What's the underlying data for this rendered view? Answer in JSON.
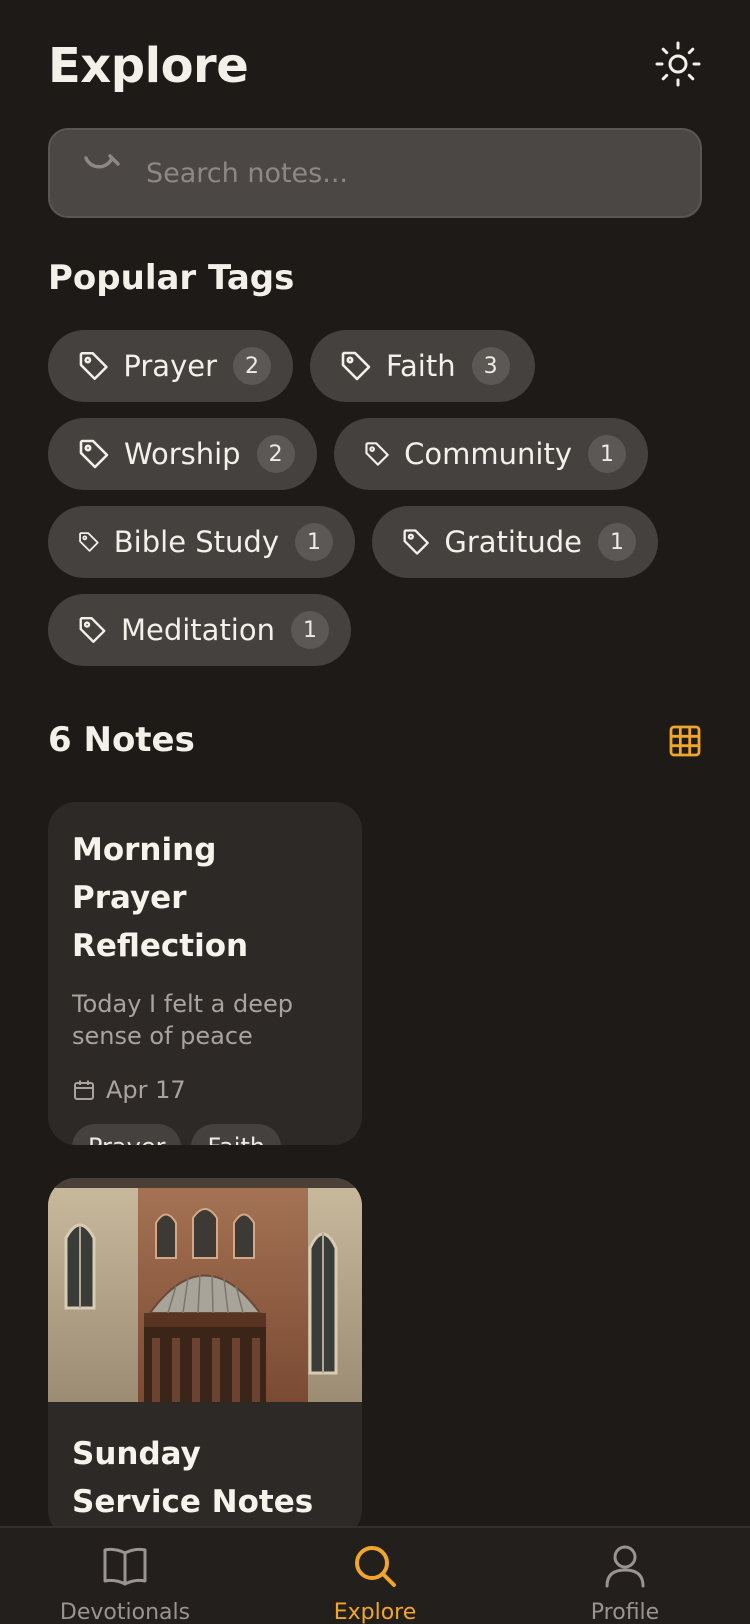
{
  "header": {
    "title": "Explore",
    "theme_icon": "sun-icon"
  },
  "search": {
    "placeholder": "Search notes..."
  },
  "tags_section": {
    "title": "Popular Tags",
    "tags": [
      {
        "label": "Prayer",
        "count": "2"
      },
      {
        "label": "Faith",
        "count": "3"
      },
      {
        "label": "Worship",
        "count": "2"
      },
      {
        "label": "Community",
        "count": "1"
      },
      {
        "label": "Bible Study",
        "count": "1"
      },
      {
        "label": "Gratitude",
        "count": "1"
      },
      {
        "label": "Meditation",
        "count": "1"
      }
    ]
  },
  "notes_section": {
    "title": "6 Notes",
    "view_toggle_icon": "grid-icon",
    "notes": [
      {
        "title": "Morning Prayer Reflection",
        "excerpt": "Today I felt a deep sense of peace during...",
        "date": "Apr 17",
        "tags": [
          "Prayer",
          "Faith"
        ]
      },
      {
        "title": "Sunday Service Notes",
        "image": "cathedral-facade-photo"
      }
    ]
  },
  "bottom_nav": {
    "items": [
      {
        "label": "Devotionals",
        "icon": "book-icon",
        "active": false
      },
      {
        "label": "Explore",
        "icon": "search-icon",
        "active": true
      },
      {
        "label": "Profile",
        "icon": "user-icon",
        "active": false
      }
    ]
  },
  "colors": {
    "background": "#1d1a18",
    "surface": "#2c2927",
    "chip": "#45413e",
    "accent": "#f0a62a",
    "text": "#f3efe9",
    "muted": "#a9a39e"
  }
}
